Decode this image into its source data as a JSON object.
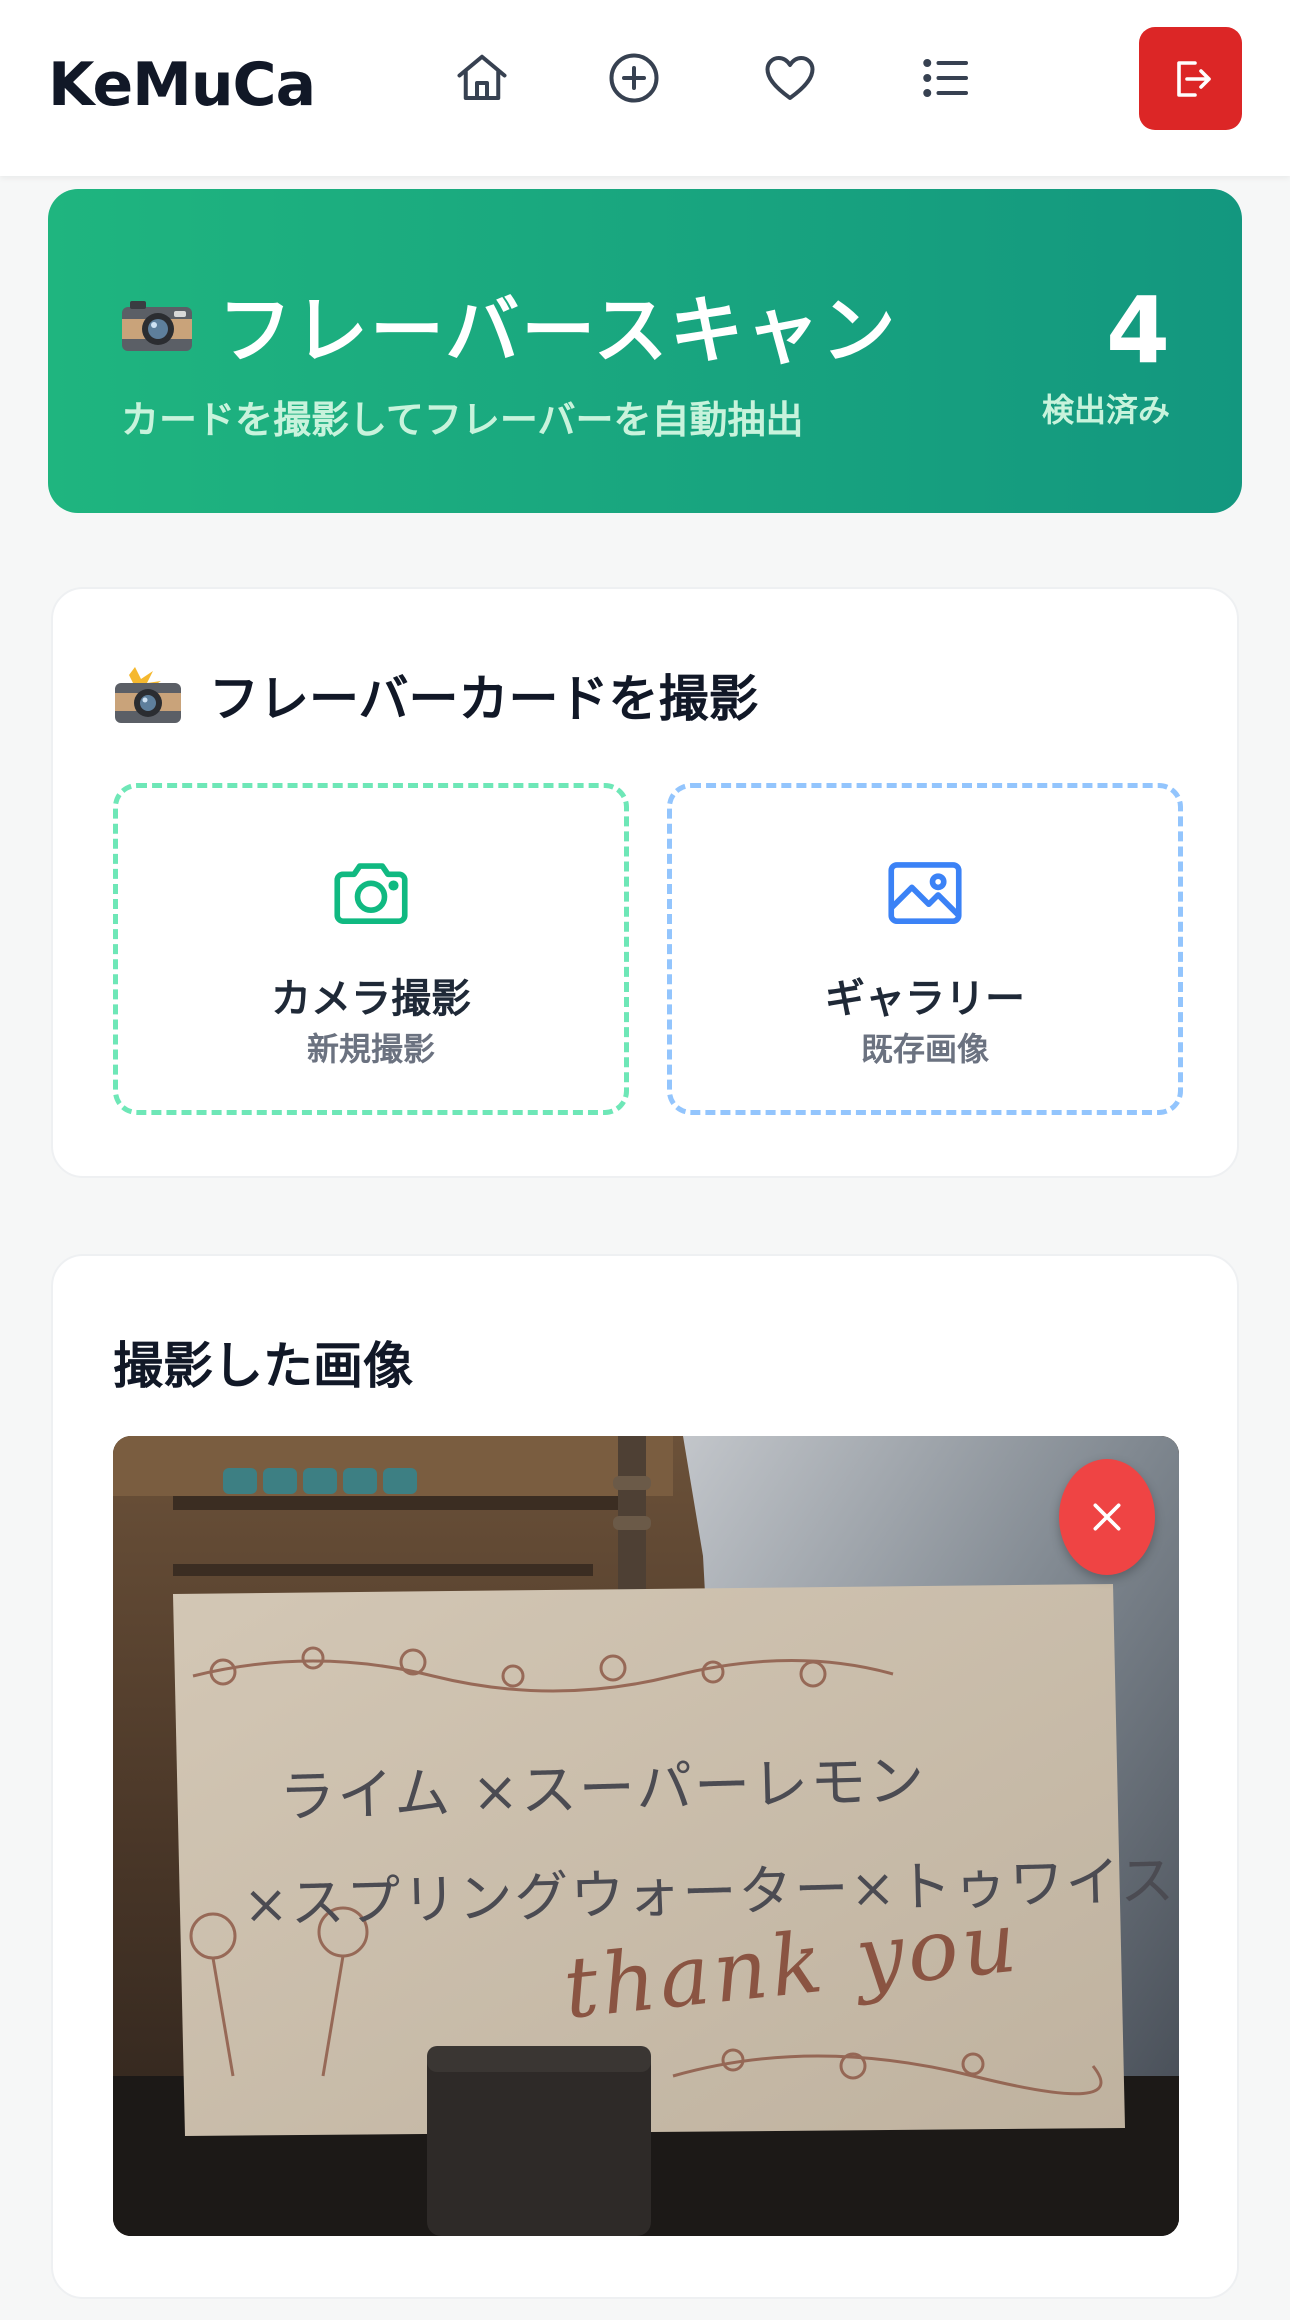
{
  "header": {
    "logo": "KeMuCa",
    "nav": [
      {
        "icon": "home-icon"
      },
      {
        "icon": "plus-circle-icon"
      },
      {
        "icon": "heart-icon"
      },
      {
        "icon": "list-icon"
      }
    ],
    "logout_icon": "logout-icon",
    "logout_color": "#dc2626"
  },
  "hero": {
    "emoji": "📷",
    "title": "フレーバースキャン",
    "subtitle": "カードを撮影してフレーバーを自動抽出",
    "count": "4",
    "count_label": "検出済み",
    "gradient": [
      "#1fb57f",
      "#13977f"
    ]
  },
  "capture": {
    "emoji": "📸",
    "title": "フレーバーカードを撮影",
    "options": [
      {
        "icon": "camera-icon",
        "label": "カメラ撮影",
        "sub": "新規撮影",
        "color": "#10b981"
      },
      {
        "icon": "image-icon",
        "label": "ギャラリー",
        "sub": "既存画像",
        "color": "#3b82f6"
      }
    ]
  },
  "captured": {
    "title": "撮影した画像",
    "photo_text": {
      "line1": "ライム ×スーパーレモン",
      "line2": "×スプリングウォーター×トゥワイス",
      "thanks": "thank you"
    },
    "remove_icon": "close-icon",
    "remove_color": "#ef4444"
  }
}
